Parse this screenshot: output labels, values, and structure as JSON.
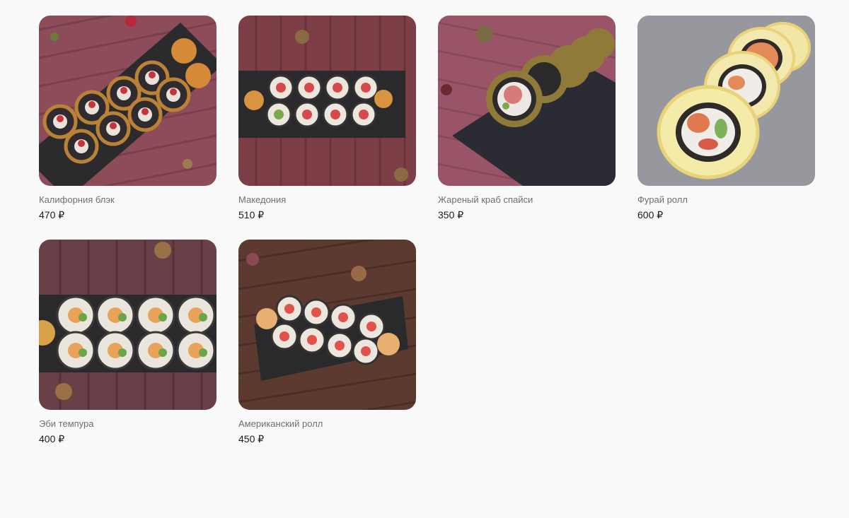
{
  "products": [
    {
      "name": "Калифорния блэк",
      "price": "470 ₽",
      "photo": "rolls-black-tempura-photo"
    },
    {
      "name": "Македония",
      "price": "510 ₽",
      "photo": "rolls-on-slate-photo"
    },
    {
      "name": "Жареный краб спайси",
      "price": "350 ₽",
      "photo": "fried-crab-rolls-photo"
    },
    {
      "name": "Фурай ролл",
      "price": "600 ₽",
      "photo": "furai-rolls-photo"
    },
    {
      "name": "Эби темпура",
      "price": "400 ₽",
      "photo": "ebi-tempura-rolls-photo"
    },
    {
      "name": "Американский ролл",
      "price": "450 ₽",
      "photo": "american-rolls-photo"
    }
  ],
  "colors": {
    "background": "#f9f9fa",
    "name_text": "#6f6f73",
    "price_text": "#1b1b1d",
    "wood_pink": "#8a4a58",
    "wood_brown": "#5a3a30",
    "slate": "#2a2a2e",
    "stone_grey": "#8d8f93"
  }
}
